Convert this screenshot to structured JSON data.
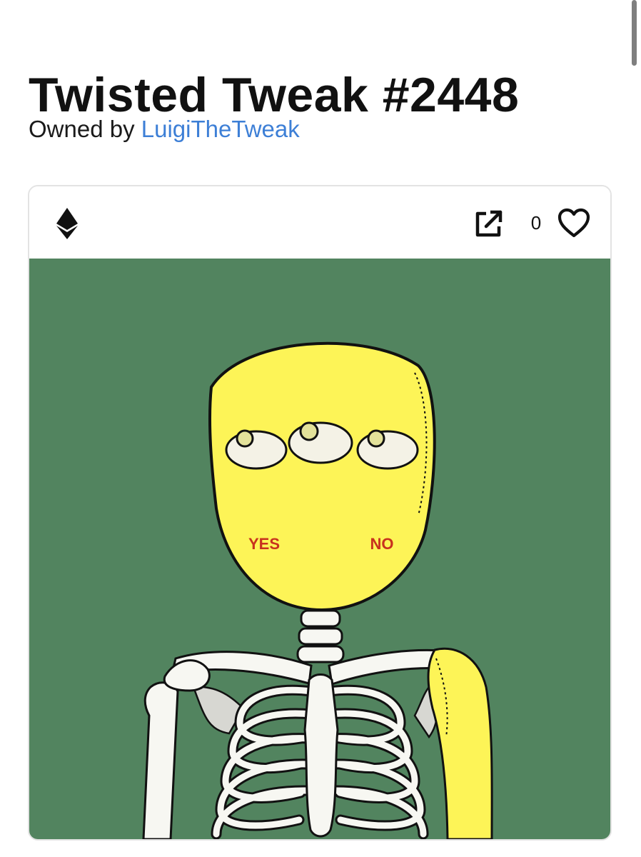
{
  "nft": {
    "title": "Twisted Tweak #2448",
    "owned_by_label": "Owned by",
    "owner_name": "LuigiTheTweak",
    "like_count": "0",
    "chain_icon": "ethereum-icon",
    "colors": {
      "title": "#111111",
      "owner_link": "#3d7fd6",
      "art_background": "#52845f",
      "head_yellow": "#fdf457"
    }
  },
  "artwork": {
    "cheek_left_text": "YES",
    "cheek_right_text": "NO"
  }
}
